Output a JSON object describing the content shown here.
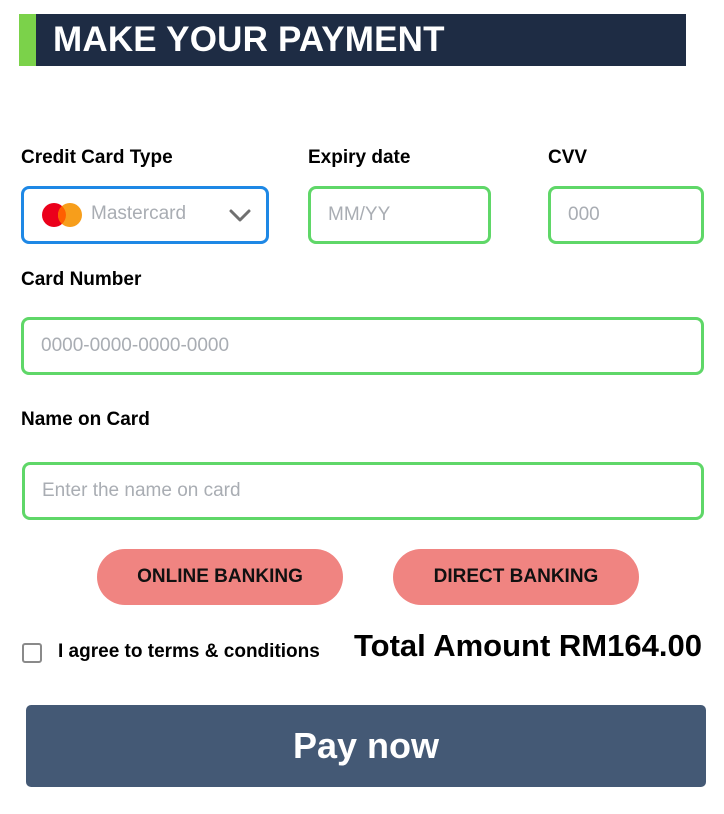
{
  "header": {
    "title": "MAKE YOUR PAYMENT",
    "accent_color": "#7bd24a",
    "background_color": "#1e2c44"
  },
  "form": {
    "card_type": {
      "label": "Credit Card Type",
      "selected": "Mastercard",
      "icon": "mastercard-logo",
      "chevron_icon": "chevron-down-icon"
    },
    "expiry": {
      "label": "Expiry date",
      "placeholder": "MM/YY",
      "value": ""
    },
    "cvv": {
      "label": "CVV",
      "placeholder": "000",
      "value": ""
    },
    "card_number": {
      "label": "Card Number",
      "placeholder": "0000-0000-0000-0000",
      "value": ""
    },
    "name_on_card": {
      "label": "Name on Card",
      "placeholder": "Enter the name on card",
      "value": ""
    },
    "field_border_color": "#5fd768",
    "select_border_color": "#1e88e5"
  },
  "payment_options": {
    "online_banking": "ONLINE BANKING",
    "direct_banking": "DIRECT BANKING",
    "color": "#f08481"
  },
  "terms": {
    "label": "I agree to terms & conditions",
    "checked": false
  },
  "total": {
    "text": "Total Amount RM164.00"
  },
  "pay_button": {
    "label": "Pay now",
    "color": "#445975"
  }
}
